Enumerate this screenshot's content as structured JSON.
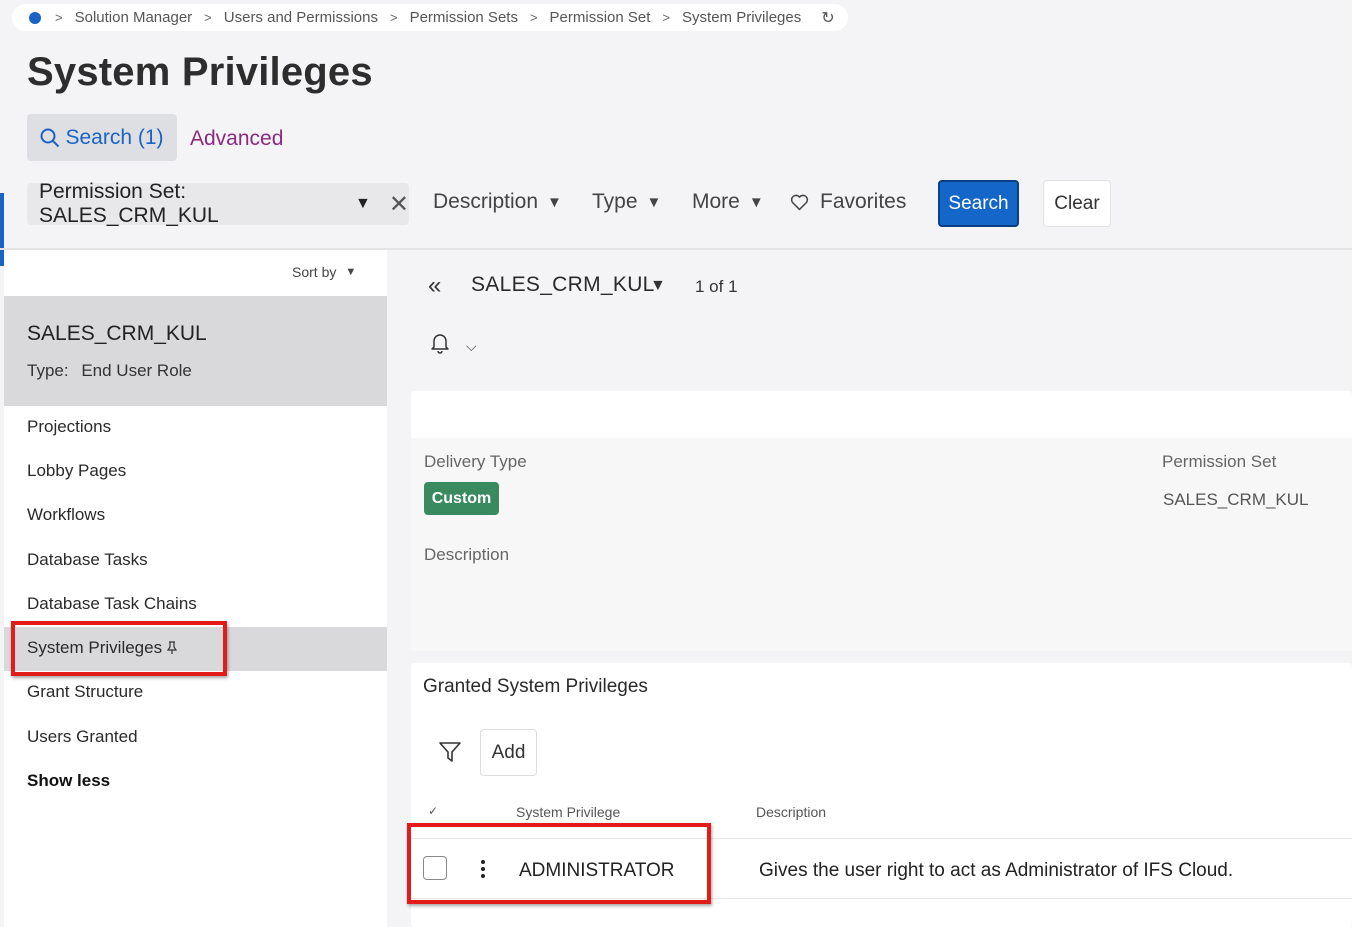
{
  "breadcrumb": {
    "items": [
      "Solution Manager",
      "Users and Permissions",
      "Permission Sets",
      "Permission Set",
      "System Privileges"
    ],
    "refresh_icon": "refresh-icon"
  },
  "page": {
    "title": "System Privileges"
  },
  "search_tabs": {
    "search_label": "Search (1)",
    "advanced_label": "Advanced"
  },
  "filters": {
    "chip_label": "Permission Set: SALES_CRM_KUL",
    "description_label": "Description",
    "type_label": "Type",
    "more_label": "More",
    "favorites_label": "Favorites",
    "search_button": "Search",
    "clear_button": "Clear"
  },
  "sidebar": {
    "sort_label": "Sort by",
    "selected": {
      "name": "SALES_CRM_KUL",
      "type_label": "Type:",
      "type_value": "End User Role"
    },
    "items": [
      {
        "label": "Projections"
      },
      {
        "label": "Lobby Pages"
      },
      {
        "label": "Workflows"
      },
      {
        "label": "Database Tasks"
      },
      {
        "label": "Database Task Chains"
      },
      {
        "label": "System Privileges"
      },
      {
        "label": "Grant Structure"
      },
      {
        "label": "Users Granted"
      }
    ],
    "show_less": "Show less"
  },
  "record": {
    "name": "SALES_CRM_KUL",
    "count": "1 of 1"
  },
  "details": {
    "delivery_type_label": "Delivery Type",
    "delivery_type_value": "Custom",
    "permission_set_label": "Permission Set",
    "permission_set_value": "SALES_CRM_KUL",
    "description_label": "Description"
  },
  "granted": {
    "title": "Granted System Privileges",
    "add_label": "Add",
    "columns": [
      "System Privilege",
      "Description"
    ],
    "rows": [
      {
        "privilege": "ADMINISTRATOR",
        "description": "Gives the user right to act as Administrator of IFS Cloud."
      }
    ]
  },
  "colors": {
    "accent": "#1a62c4",
    "badge": "#3a8a5f",
    "highlight": "#e31b1b",
    "advanced": "#8a2a80"
  }
}
